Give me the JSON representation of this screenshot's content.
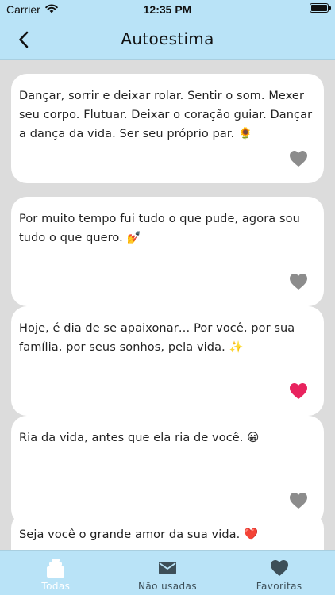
{
  "status_bar": {
    "carrier": "Carrier",
    "time": "12:35 PM"
  },
  "header": {
    "title": "Autoestima",
    "back_icon": "chevron-left-icon"
  },
  "quotes": [
    {
      "text": "Dançar, sorrir e deixar rolar. Sentir o som. Mexer seu corpo. Flutuar. Deixar o coração guiar. Dançar a dança da vida. Ser seu próprio par. 🌻",
      "favorite": false
    },
    {
      "text": "Por muito tempo fui tudo o que pude, agora sou tudo o que quero. 💅",
      "favorite": false
    },
    {
      "text": "Hoje, é dia de se apaixonar… Por você, por sua família, por seus sonhos, pela vida. ✨",
      "favorite": true
    },
    {
      "text": "Ria da vida, antes que ela ria de você. 😀",
      "favorite": false
    },
    {
      "text": "Seja você o grande amor da sua vida. ❤️",
      "favorite": false
    }
  ],
  "tabs": [
    {
      "label": "Todas",
      "icon": "cards-icon",
      "active": true
    },
    {
      "label": "Não usadas",
      "icon": "envelope-icon",
      "active": false
    },
    {
      "label": "Favoritas",
      "icon": "heart-icon",
      "active": false
    }
  ],
  "colors": {
    "bar_background": "#b9e3f7",
    "page_background": "#dcdcdc",
    "heart_active": "#e8235e",
    "heart_inactive": "#8c8c8c",
    "tab_active": "#ffffff",
    "tab_inactive": "#3d4f58"
  }
}
